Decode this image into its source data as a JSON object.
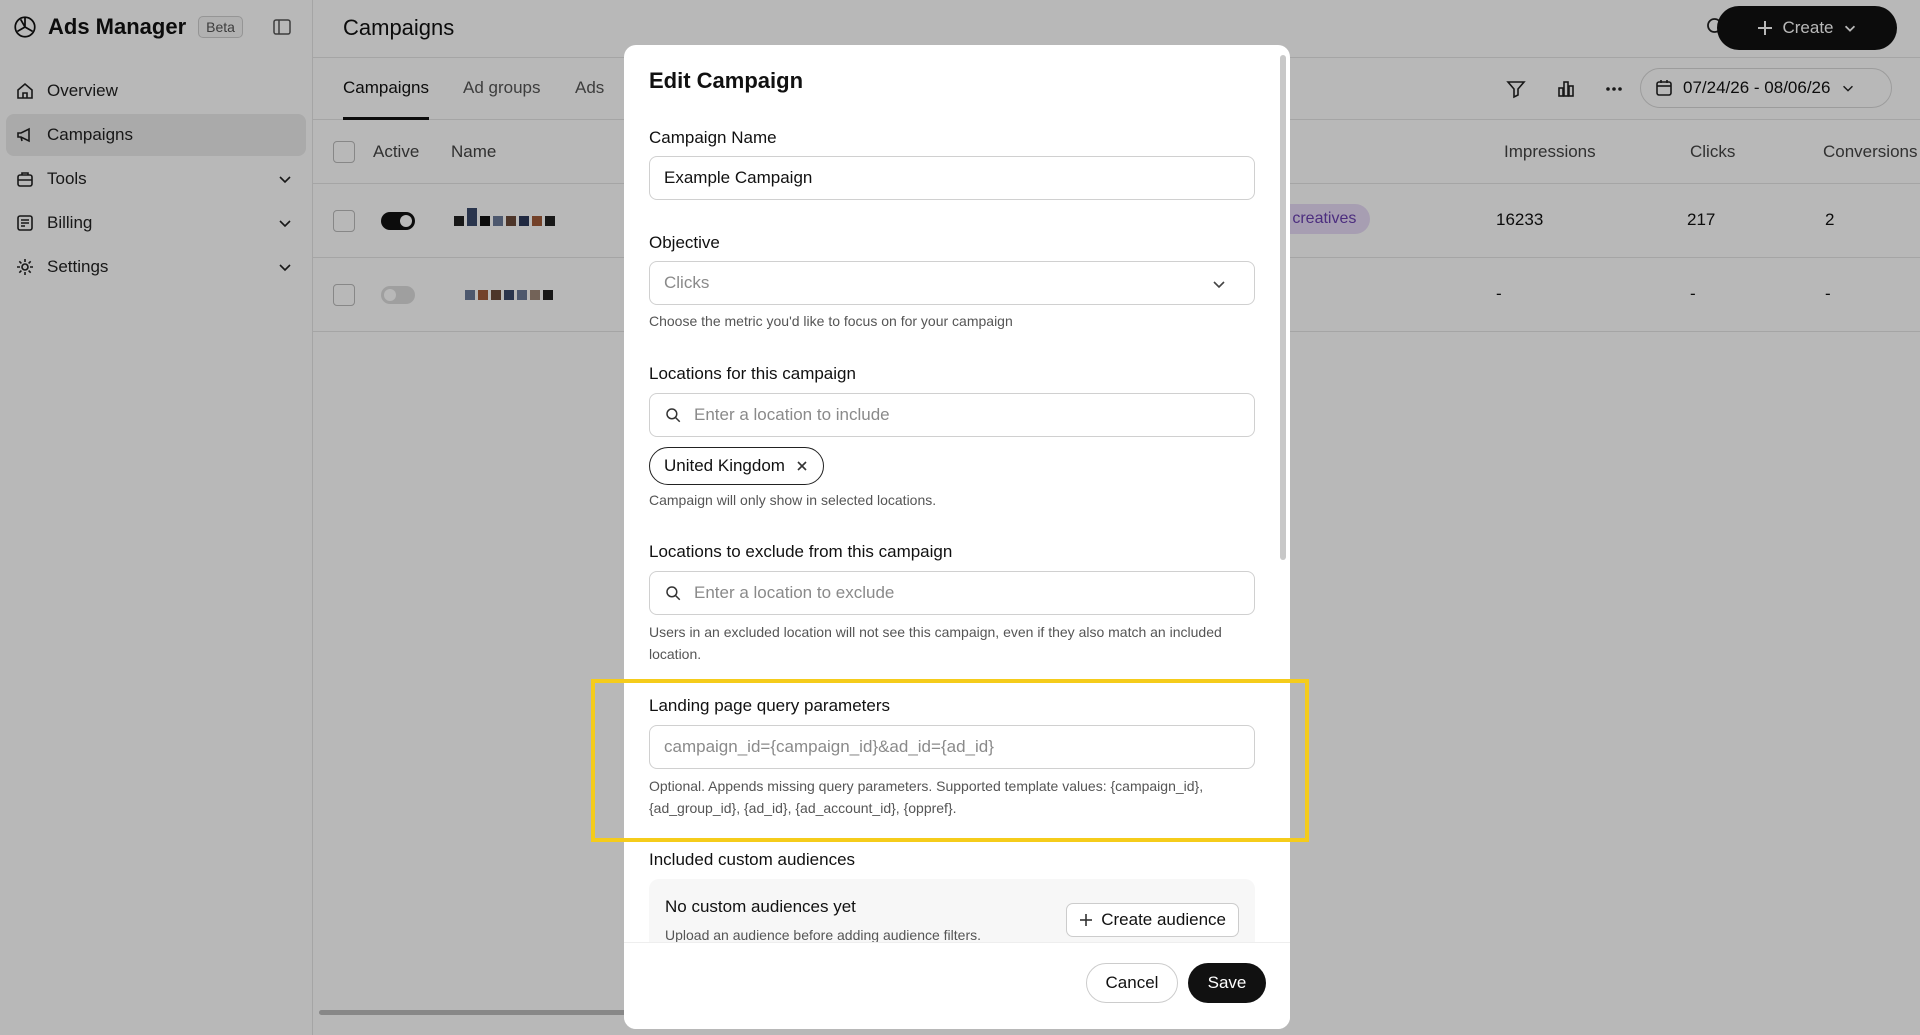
{
  "app": {
    "name": "Ads Manager",
    "badge": "Beta"
  },
  "sidebar": {
    "items": [
      {
        "label": "Overview",
        "icon": "home-icon"
      },
      {
        "label": "Campaigns",
        "icon": "megaphone-icon"
      },
      {
        "label": "Tools",
        "icon": "toolbox-icon"
      },
      {
        "label": "Billing",
        "icon": "receipt-icon"
      },
      {
        "label": "Settings",
        "icon": "gear-icon"
      }
    ]
  },
  "header": {
    "title": "Campaigns",
    "create_label": "Create"
  },
  "tabs": [
    "Campaigns",
    "Ad groups",
    "Ads"
  ],
  "date_range": "07/24/26 - 08/06/26",
  "table": {
    "columns": {
      "active": "Active",
      "name": "Name",
      "impressions": "Impressions",
      "clicks": "Clicks",
      "conversions": "Conversions"
    },
    "rows": [
      {
        "active": true,
        "status": "d creatives",
        "impressions": "16233",
        "clicks": "217",
        "conversions": "2"
      },
      {
        "active": false,
        "status": "",
        "impressions": "-",
        "clicks": "-",
        "conversions": "-"
      }
    ]
  },
  "modal": {
    "title": "Edit Campaign",
    "campaign_name": {
      "label": "Campaign Name",
      "value": "Example Campaign"
    },
    "objective": {
      "label": "Objective",
      "value": "Clicks",
      "help": "Choose the metric you'd like to focus on for your campaign"
    },
    "locations_include": {
      "label": "Locations for this campaign",
      "placeholder": "Enter a location to include",
      "chip": "United Kingdom",
      "help": "Campaign will only show in selected locations."
    },
    "locations_exclude": {
      "label": "Locations to exclude from this campaign",
      "placeholder": "Enter a location to exclude",
      "help": "Users in an excluded location will not see this campaign, even if they also match an included location."
    },
    "query_params": {
      "label": "Landing page query parameters",
      "placeholder": "campaign_id={campaign_id}&ad_id={ad_id}",
      "help": "Optional. Appends missing query parameters. Supported template values: {campaign_id}, {ad_group_id}, {ad_id}, {ad_account_id}, {oppref}."
    },
    "audiences": {
      "label": "Included custom audiences",
      "empty_title": "No custom audiences yet",
      "empty_sub": "Upload an audience before adding audience filters.",
      "create_label": "Create audience"
    },
    "cancel_label": "Cancel",
    "save_label": "Save"
  },
  "colors": {
    "highlight": "#f5cc1b",
    "primary": "#111111",
    "badge_bg": "#e8dcf7"
  }
}
